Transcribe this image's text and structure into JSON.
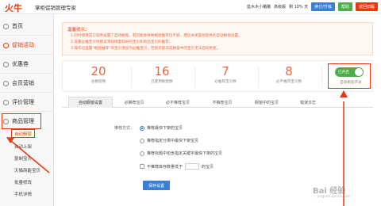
{
  "topbar": {
    "logo": "火牛",
    "title": "掌柜促销管理专家",
    "user_info": "蓝木木小猪猪",
    "version": "高级版",
    "days": "剩 10% 天",
    "btn1": "续订/升级",
    "btn2": "帮助",
    "btn3": "返回旧版"
  },
  "sidebar": {
    "items": [
      {
        "label": "首页"
      },
      {
        "label": "促销活动"
      },
      {
        "label": "优惠券"
      },
      {
        "label": "会员营销"
      },
      {
        "label": "评价管理"
      },
      {
        "label": "商品管理"
      }
    ],
    "subitems": [
      "自动橱窗",
      "自动上架",
      "复制宝贝",
      "天猫商能宝贝",
      "批量修改",
      "手机详情"
    ]
  },
  "notice": {
    "title": "温馨提示：",
    "lines": [
      "1.同时使用其它软件设置了自动橱窗，有可能会导致橱窗推荐位不够，建议关闭其他软件的自动橱窗设置。",
      "2.设置必推宝贝时建议添加销量较好的宝贝和新品宝贝的推荐。",
      "3.操作已设置“橱窗推荐”的宝贝添加为必推宝贝，否则可能造成橱窗中的宝贝无法自动更新。"
    ]
  },
  "stats": [
    {
      "num": "20",
      "label": "总橱窗数"
    },
    {
      "num": "16",
      "label": "已使用橱窗数"
    },
    {
      "num": "7",
      "label": "必推荐宝贝数"
    },
    {
      "num": "8",
      "label": "必不推荐宝贝数"
    }
  ],
  "toggle": {
    "state": "已开启",
    "label": "自动橱窗开关"
  },
  "tabs": [
    "自动橱窗设置",
    "必推荐宝贝",
    "必不推荐宝贝",
    "不推荐宝贝",
    "橱窗中的宝贝",
    "错误日志"
  ],
  "form": {
    "label": "推荐方式：",
    "options": [
      "推荐最快下架的宝贝",
      "推荐指定分类中最快下架宝贝",
      "推荐标题中包含指定关键字最快下架的宝贝",
      "不推荐库存数量低于",
      "的宝贝"
    ],
    "save": "保存设置"
  },
  "watermark": {
    "main": "Bai 经验",
    "sub": "jingyan.baidu.com"
  },
  "colors": {
    "accent": "#e8380d",
    "blue": "#3a7fd5",
    "green": "#4cae4c"
  }
}
